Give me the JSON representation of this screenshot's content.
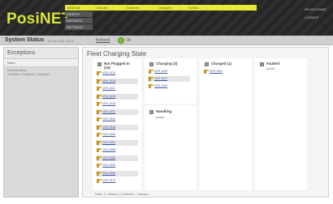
{
  "header": {
    "logo": "PosiNET",
    "top_tabs": [
      "STATUS",
      "Vehicles",
      "Batteries",
      "Chargers",
      "Events"
    ],
    "side_menu": [
      "ASSETS",
      "REPORTS",
      "SETTINGS"
    ],
    "right_links": [
      "MY ACCOUNT",
      "LOGOUT"
    ],
    "colors": {
      "accent": "#e6ea3a",
      "logo": "#d8e437",
      "background": "#2e2e2e"
    }
  },
  "status_bar": {
    "title": "System Status",
    "timestamp": "14 Jan 2011 10:23",
    "link": "Refresh",
    "ok_text": "Ok",
    "ok_color": "#7fbb3a"
  },
  "exceptions": {
    "title": "Exceptions",
    "row_head": "None",
    "row_text_1": "Network status:",
    "row_text_2": "3 vehicles, 0 batteries, 0 chargers"
  },
  "fleet": {
    "title": "Fleet Charging State",
    "columns": [
      {
        "label": "Not Plugged In (15)",
        "items": [
          "VEH-1012",
          "VEH-1018",
          "VEH-1021",
          "VEH-1025",
          "VEH-1033",
          "VEH-1037",
          "VEH-1040",
          "VEH-1044",
          "VEH-1046",
          "VEH-1051",
          "VEH-1055",
          "VEH-1058",
          "VEH-1062",
          "VEH-1066",
          "VEH-1070"
        ]
      },
      {
        "label": "Charging (3)",
        "items": [
          "VEH-1003",
          "VEH-1007",
          "VEH-1009"
        ]
      },
      {
        "label": "Charged (1)",
        "items": [
          "VEH-1001"
        ]
      },
      {
        "label": "Faulted",
        "none": "(none)"
      }
    ],
    "handling": {
      "label": "Handling",
      "none": "(none)"
    },
    "footer": "Totals: 17 vehicles, 13 batteries, 7 chargers"
  }
}
